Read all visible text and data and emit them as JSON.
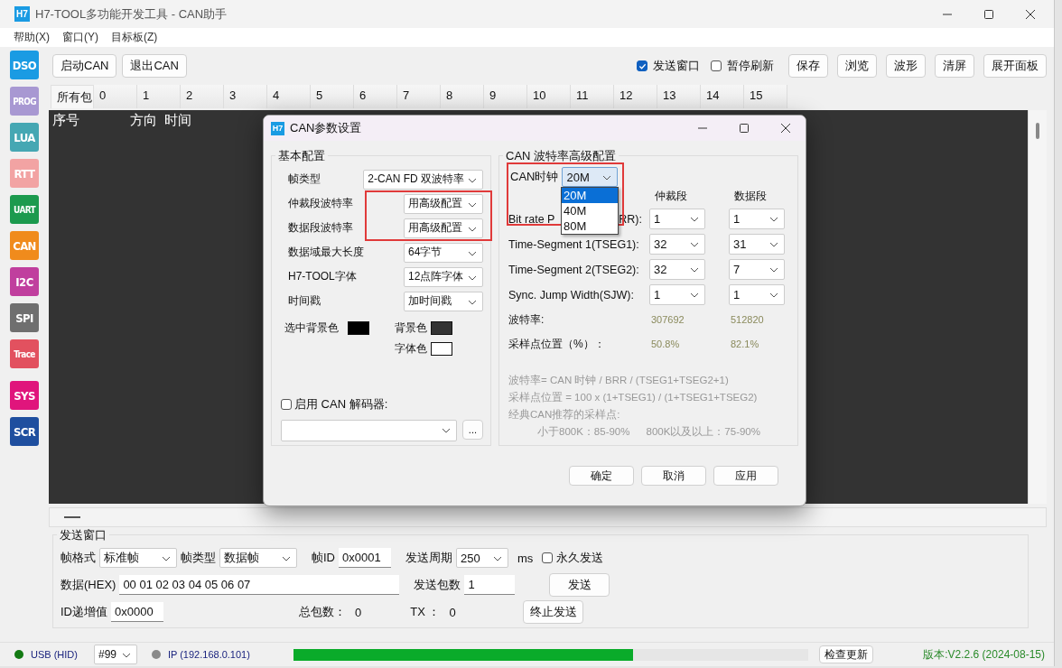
{
  "window": {
    "app_icon": "H7",
    "title": "H7-TOOL多功能开发工具 - CAN助手"
  },
  "menu": [
    "帮助(X)",
    "窗口(Y)",
    "目标板(Z)"
  ],
  "sidebar": [
    {
      "label": "DSO",
      "color": "#1a9be3"
    },
    {
      "label": "PROG",
      "color": "#a898d2"
    },
    {
      "label": "LUA",
      "color": "#45a7b3"
    },
    {
      "label": "RTT",
      "color": "#f2a3a3"
    },
    {
      "label": "UART",
      "color": "#1c9a4e"
    },
    {
      "label": "CAN",
      "color": "#f08b1c"
    },
    {
      "label": "I2C",
      "color": "#c03f9e"
    },
    {
      "label": "SPI",
      "color": "#6f6f6f"
    },
    {
      "label": "Trace",
      "color": "#e2515f"
    },
    {
      "label": "SYS",
      "color": "#e0157c"
    },
    {
      "label": "SCR",
      "color": "#1f4f9f"
    }
  ],
  "toolbar": {
    "left_buttons": [
      "启动CAN",
      "退出CAN"
    ],
    "checkboxes": [
      {
        "label": "发送窗口",
        "checked": true
      },
      {
        "label": "暂停刷新",
        "checked": false
      }
    ],
    "right_buttons": [
      "保存",
      "浏览",
      "波形",
      "清屏",
      "展开面板"
    ]
  },
  "channel_tabs": [
    {
      "label": "所有包",
      "selected": true
    },
    {
      "label": "0",
      "selected": false
    },
    {
      "label": "1",
      "selected": false
    },
    {
      "label": "2",
      "selected": false
    },
    {
      "label": "3",
      "selected": false
    },
    {
      "label": "4",
      "selected": false
    },
    {
      "label": "5",
      "selected": false
    },
    {
      "label": "6",
      "selected": false
    },
    {
      "label": "7",
      "selected": false
    },
    {
      "label": "8",
      "selected": false
    },
    {
      "label": "9",
      "selected": false
    },
    {
      "label": "10",
      "selected": false
    },
    {
      "label": "11",
      "selected": false
    },
    {
      "label": "12",
      "selected": false
    },
    {
      "label": "13",
      "selected": false
    },
    {
      "label": "14",
      "selected": false
    },
    {
      "label": "15",
      "selected": false
    }
  ],
  "log_table": {
    "columns": [
      "序号",
      "方向",
      "时间"
    ]
  },
  "dialog": {
    "icon": "H7",
    "title": "CAN参数设置",
    "basic": {
      "title": "基本配置",
      "fields": [
        {
          "label": "帧类型",
          "value": "2-CAN FD 双波特率",
          "highlighted": false
        },
        {
          "label": "仲裁段波特率",
          "value": "用高级配置",
          "highlighted": true
        },
        {
          "label": "数据段波特率",
          "value": "用高级配置",
          "highlighted": true
        },
        {
          "label": "数据域最大长度",
          "value": "64字节",
          "highlighted": false
        },
        {
          "label": "H7-TOOL字体",
          "value": "12点阵字体",
          "highlighted": false
        },
        {
          "label": "时间戳",
          "value": "加时间戳",
          "highlighted": false
        }
      ],
      "colors": [
        {
          "label": "选中背景色",
          "color": "#000000"
        },
        {
          "label": "背景色",
          "color": "#333333"
        },
        {
          "label": "字体色",
          "color": "#ffffff"
        }
      ],
      "decoder": {
        "label": "启用 CAN 解码器:",
        "checked": false,
        "browse": "..."
      }
    },
    "advanced": {
      "title": "CAN 波特率高级配置",
      "clock": {
        "label": "CAN时钟",
        "value": "20M",
        "highlighted": true,
        "options": [
          {
            "label": "20M",
            "selected": true
          },
          {
            "label": "40M",
            "selected": false
          },
          {
            "label": "80M",
            "selected": false
          }
        ]
      },
      "columns": [
        "仲裁段",
        "数据段"
      ],
      "rows": [
        {
          "label": "Bit rate  P",
          "label_tail": "RR):",
          "arbitration": "1",
          "data": "1"
        },
        {
          "label": "Time-Segment 1(TSEG1):",
          "arbitration": "32",
          "data": "31"
        },
        {
          "label": "Time-Segment 2(TSEG2):",
          "arbitration": "32",
          "data": "7"
        },
        {
          "label": "Sync. Jump Width(SJW):",
          "arbitration": "1",
          "data": "1"
        }
      ],
      "results": [
        {
          "label": "波特率:",
          "arbitration": "307692",
          "data": "512820"
        },
        {
          "label": "采样点位置（%）：",
          "arbitration": "50.8%",
          "data": "82.1%"
        }
      ],
      "notes": [
        "波特率= CAN 时钟 / BRR / (TSEG1+TSEG2+1)",
        "采样点位置 = 100 x (1+TSEG1) / (1+TSEG1+TSEG2)",
        "经典CAN推荐的采样点:"
      ],
      "recommendations": [
        "小于800K：85-90%",
        "800K以及以上：75-90%"
      ]
    },
    "buttons": [
      "确定",
      "取消",
      "应用"
    ]
  },
  "send_window": {
    "title": "发送窗口",
    "frame_format": {
      "label": "帧格式",
      "value": "标准帧"
    },
    "frame_type": {
      "label": "帧类型",
      "value": "数据帧"
    },
    "frame_id": {
      "label": "帧ID",
      "value": "0x0001"
    },
    "period": {
      "label": "发送周期",
      "value": "250",
      "unit": "ms"
    },
    "forever": {
      "label": "永久发送",
      "checked": false
    },
    "data": {
      "label": "数据(HEX)",
      "value": "00 01 02 03 04 05 06 07"
    },
    "count": {
      "label": "发送包数",
      "value": "1"
    },
    "id_increment": {
      "label": "ID递增值",
      "value": "0x0000"
    },
    "total": {
      "label": "总包数：",
      "value": "0"
    },
    "tx": {
      "label": "TX ：",
      "value": "0"
    },
    "buttons": [
      "发送",
      "终止发送"
    ]
  },
  "status_bar": {
    "usb": {
      "label": "USB (HID)",
      "color": "#137a13"
    },
    "port": "#99",
    "ip": {
      "label": "IP (192.168.0.101)",
      "color": "#8a8a8a"
    },
    "progress": {
      "level": 0.66
    },
    "update_button": "检查更新",
    "version": "版本:V2.2.6 (2024-08-15)"
  }
}
